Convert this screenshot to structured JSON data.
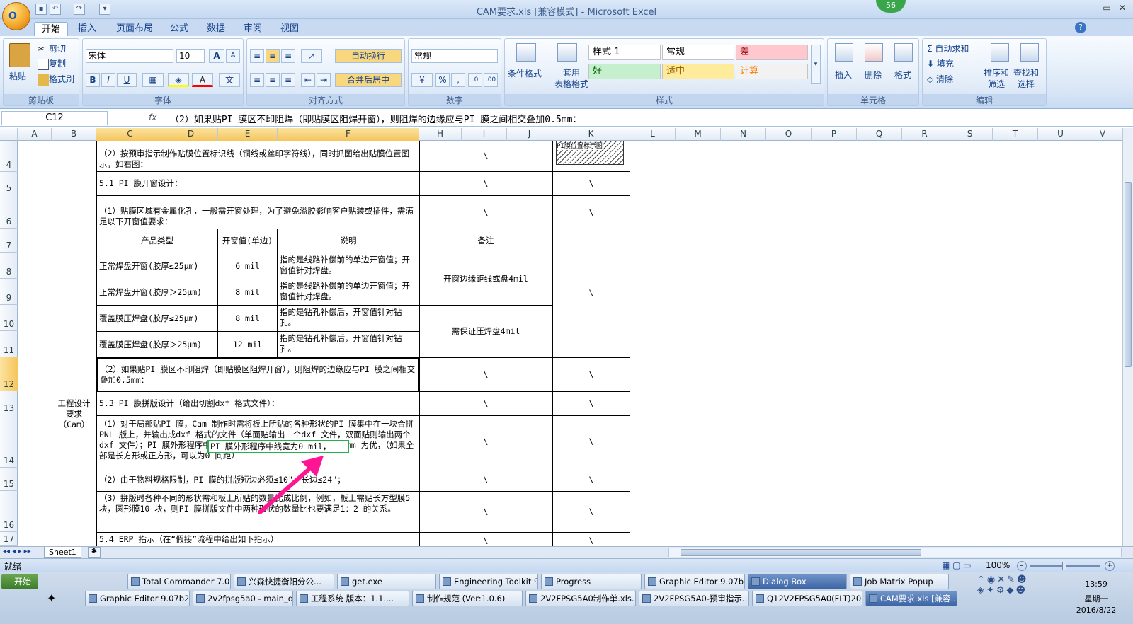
{
  "window": {
    "title": "CAM要求.xls  [兼容模式] - Microsoft Excel",
    "badge": "56",
    "orb_label": "O"
  },
  "ribbon_tabs": [
    "开始",
    "插入",
    "页面布局",
    "公式",
    "数据",
    "审阅",
    "视图"
  ],
  "clipboard": {
    "paste": "粘贴",
    "cut": "剪切",
    "copy": "复制",
    "format_painter": "格式刷",
    "label": "剪贴板"
  },
  "font": {
    "name": "宋体",
    "size": "10",
    "label": "字体",
    "bold": "B",
    "italic": "I",
    "underline": "U",
    "grow": "A",
    "shrink": "A"
  },
  "alignment": {
    "wrap": "自动换行",
    "merge": "合并后居中",
    "label": "对齐方式"
  },
  "number": {
    "format": "常规",
    "percent": "%",
    "comma": ",",
    "label": "数字"
  },
  "styles": {
    "conditional": "条件格式",
    "as_table": "套用\n表格格式",
    "label": "样式",
    "cells": [
      {
        "text": "样式 1",
        "bg": "#ffffff",
        "fg": "#000000"
      },
      {
        "text": "常规",
        "bg": "#ffffff",
        "fg": "#000000"
      },
      {
        "text": "差",
        "bg": "#ffc7ce",
        "fg": "#9c0006"
      },
      {
        "text": "好",
        "bg": "#c6efce",
        "fg": "#006100"
      },
      {
        "text": "适中",
        "bg": "#ffeb9c",
        "fg": "#9c6500"
      },
      {
        "text": "计算",
        "bg": "#f2f2f2",
        "fg": "#fa7d00"
      }
    ]
  },
  "cells_group": {
    "insert": "插入",
    "delete": "删除",
    "format": "格式",
    "label": "单元格"
  },
  "editing": {
    "autosum": "自动求和",
    "fill": "填充",
    "clear": "清除",
    "sort": "排序和\n筛选",
    "find": "查找和\n选择",
    "label": "编辑"
  },
  "formula_bar": {
    "name_box": "C12",
    "fx": "fx",
    "formula": "（2）如果贴PI 膜区不印阻焊（即贴膜区阻焊开窗），则阻焊的边缘应与PI 膜之间相交叠加0.5mm："
  },
  "columns": [
    "A",
    "B",
    "C",
    "D",
    "E",
    "F",
    "H",
    "I",
    "J",
    "K",
    "L",
    "M",
    "N",
    "O",
    "P",
    "Q",
    "R",
    "S",
    "T",
    "U",
    "V"
  ],
  "rows": [
    "4",
    "5",
    "6",
    "7",
    "8",
    "9",
    "10",
    "11",
    "12",
    "13",
    "14",
    "15",
    "16",
    "17"
  ],
  "sheet": {
    "r4": "（2）按预审指示制作贴膜位置标识线（铜线或丝印字符线），同时抓图给出贴膜位置图示，如右图：",
    "r4_k_img": "PI膜位置标示图",
    "r5": "5.1 PI 膜开窗设计：",
    "r6": "（1）贴膜区域有金属化孔，一般需开窗处理，为了避免溢胶影响客户贴装或插件，需满足以下开窗值要求：",
    "hdr_type": "产品类型",
    "hdr_val": "开窗值(单边)",
    "hdr_desc": "说明",
    "hdr_note": "备注",
    "r8_type": "正常焊盘开窗(胶厚≤25μm)",
    "r8_val": "6 mil",
    "r8_desc": "指的是线路补偿前的单边开窗值；开窗值针对焊盘。",
    "r9_type": "正常焊盘开窗(胶厚＞25μm)",
    "r9_val": "8 mil",
    "r9_desc": "指的是线路补偿前的单边开窗值；开窗值针对焊盘。",
    "r89_note": "开窗边缘距线或盘4mil",
    "r10_type": "覆盖膜压焊盘(胶厚≤25μm)",
    "r10_val": "8 mil",
    "r10_desc": "指的是钻孔补偿后，开窗值针对钻孔。",
    "r11_type": "覆盖膜压焊盘(胶厚＞25μm)",
    "r11_val": "12 mil",
    "r11_desc": "指的是钻孔补偿后，开窗值针对钻孔。",
    "r1011_note": "需保证压焊盘4mil",
    "r12": "（2）如果贴PI 膜区不印阻焊（即贴膜区阻焊开窗），则阻焊的边缘应与PI 膜之间相交叠加0.5mm：",
    "r13": "5.3 PI 膜拼版设计（给出切割dxf 格式文件）：",
    "r14": "（1）对于局部贴PI 膜，Cam 制作时需将板上所贴的各种形状的PI 膜集中在一块合拼PNL 版上，并输出成dxf 格式的文件（单面贴输出一个dxf 文件，双面贴则输出两个dxf 文件）；PI 膜外形程序中线宽为0 mil，各unit 之间间距以1mm 为优，（如果全部是长方形或正方形，可以为0 间距）",
    "r14_highlight": "PI 膜外形程序中线宽为0 mil，",
    "r15": "（2）由于物料规格限制，PI 膜的拼版短边必须≤10\"，长边≤24\"；",
    "r16": "（3）拼版时各种不同的形状需和板上所贴的数量比成比例，例如，板上需贴长方型膜5 块，圆形膜10 块，则PI 膜拼版文件中两种形状的数量比也要满足1：2 的关系。",
    "r17": "5.4 ERP 指示（在“假接”流程中给出如下指示）",
    "b_label": "工程设计要求（Cam）",
    "slash": "\\"
  },
  "sheet_tab": "Sheet1",
  "status": {
    "ready": "就绪",
    "zoom": "100%"
  },
  "taskbar": {
    "start": "开始",
    "row1": [
      "Total Commander 7.0 ...",
      "兴森快捷衡阳分公...",
      "get.exe",
      "Engineering Toolkit 9....",
      "Progress",
      "Graphic Editor 9.07b2 ...",
      "Dialog Box",
      "Job Matrix Popup"
    ],
    "row2": [
      "Graphic Editor 9.07b2 (...",
      "2v2fpsg5a0 - main_qa",
      "工程系统  版本：1.1....",
      "制作规范 (Ver:1.0.6)",
      "2V2FPSG5A0制作单.xls...",
      "2V2FPSG5A0-预审指示...",
      "Q12V2FPSG5A0(FLT)20...",
      "CAM要求.xls [兼容..."
    ],
    "time": "13:59",
    "day": "星期一",
    "date": "2016/8/22"
  },
  "colors": {
    "accent": "#15428b",
    "selection": "#f6c55c",
    "highlight_box": "#22b14c",
    "arrow": "#ff1493"
  }
}
